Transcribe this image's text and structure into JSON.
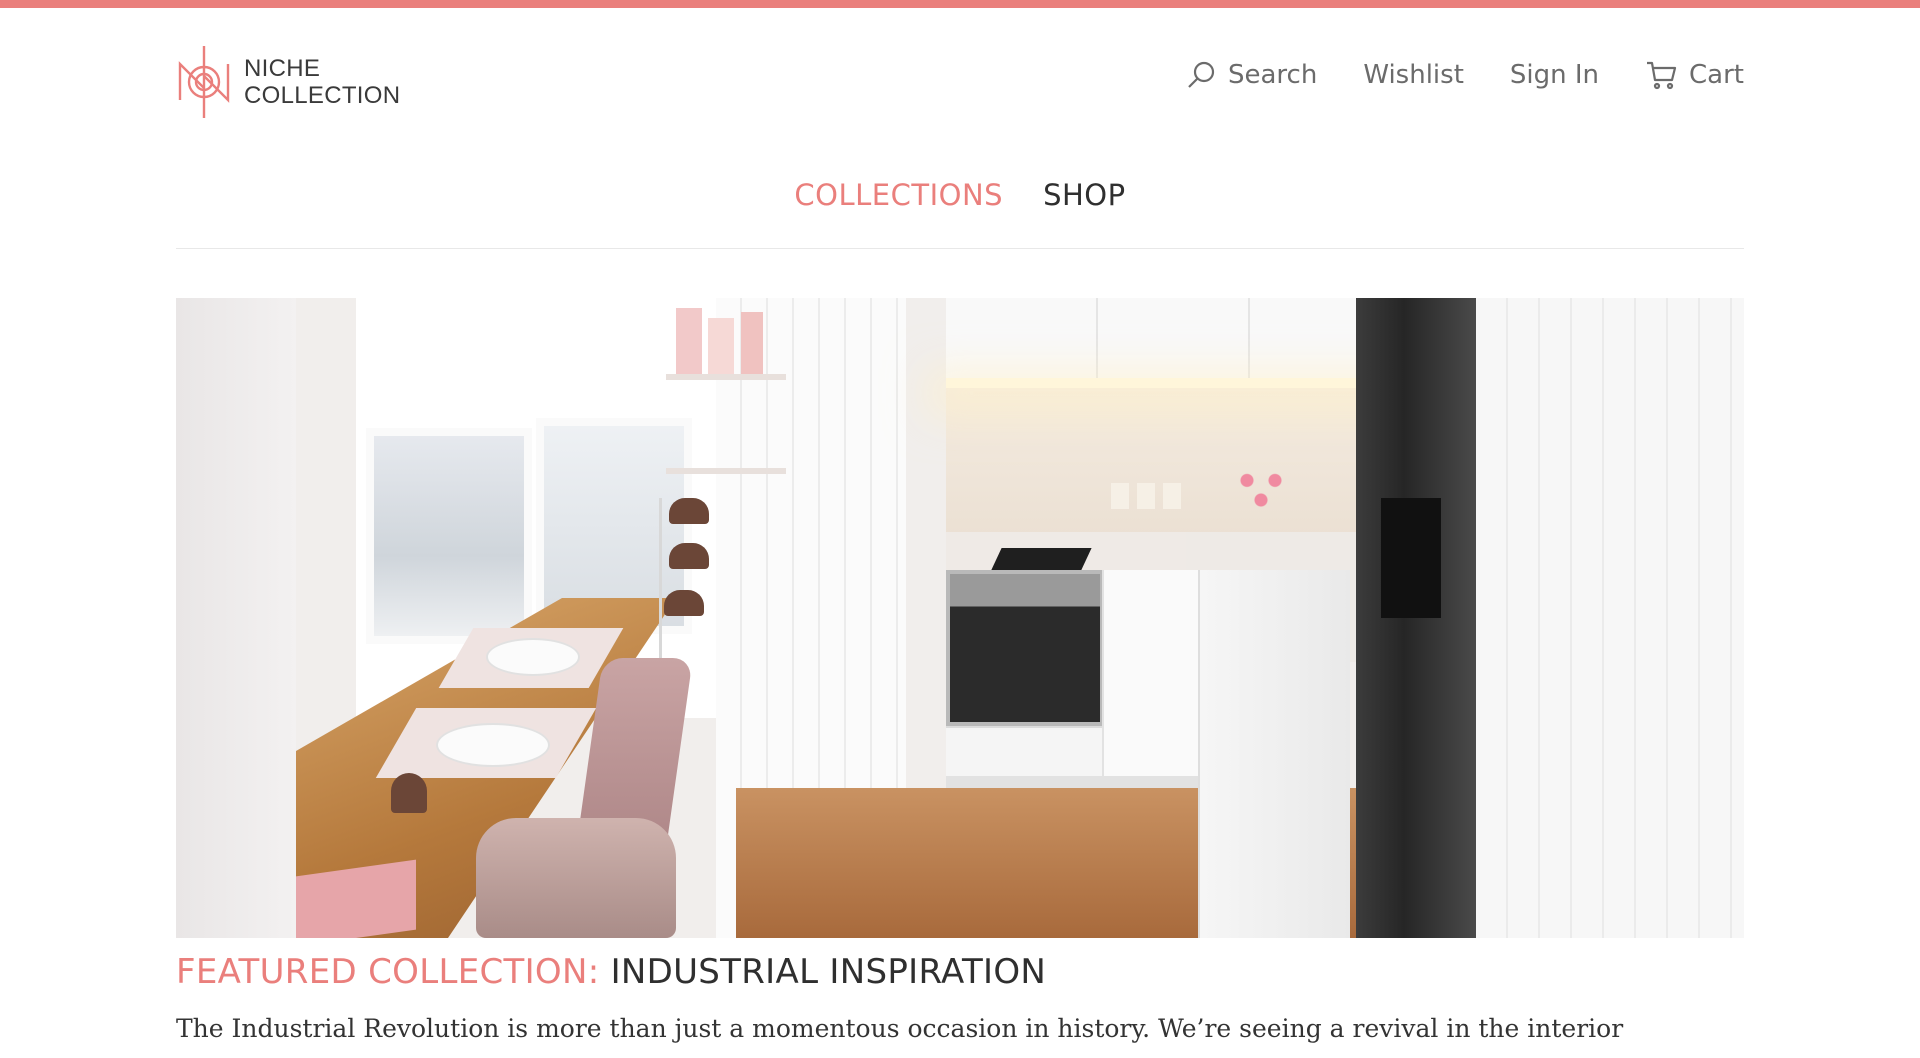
{
  "brand": {
    "name_line1": "NICHE",
    "name_line2": "COLLECTION",
    "accent_color": "#ea7f7c"
  },
  "util_nav": {
    "search_label": "Search",
    "search_icon": "search-icon",
    "wishlist_label": "Wishlist",
    "signin_label": "Sign In",
    "cart_label": "Cart",
    "cart_icon": "cart-icon"
  },
  "main_nav": {
    "items": [
      {
        "label": "COLLECTIONS",
        "active": true
      },
      {
        "label": "SHOP",
        "active": false
      }
    ]
  },
  "hero": {
    "image": "kitchen-interior-photo"
  },
  "featured": {
    "label": "FEATURED COLLECTION:",
    "name": "INDUSTRIAL INSPIRATION",
    "body": "The Industrial Revolution is more than just a momentous occasion in history. We’re seeing a revival in the interior"
  }
}
